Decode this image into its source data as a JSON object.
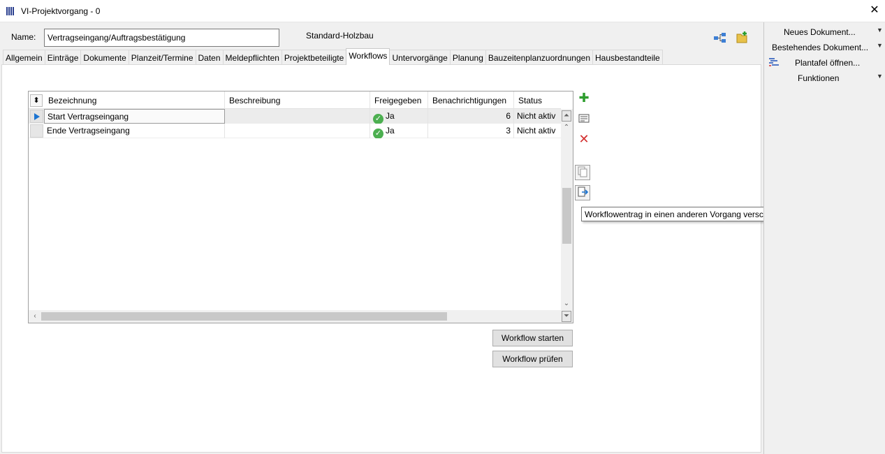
{
  "window": {
    "title": "VI-Projektvorgang - 0",
    "close_glyph": "✕"
  },
  "header": {
    "name_label": "Name:",
    "name_value": "Vertragseingang/Auftragsbestätigung",
    "category": "Standard-Holzbau",
    "icons": [
      "hierarchy-icon",
      "folder-add-icon"
    ]
  },
  "tabs": [
    "Allgemein",
    "Einträge",
    "Dokumente",
    "Planzeit/Termine",
    "Daten",
    "Meldepflichten",
    "Projektbeteiligte",
    "Workflows",
    "Untervorgänge",
    "Planung",
    "Bauzeitenplanzuordnungen",
    "Hausbestandteile"
  ],
  "active_tab": "Workflows",
  "grid": {
    "columns": [
      "Bezeichnung",
      "Beschreibung",
      "Freigegeben",
      "Benachrichtigungen",
      "Status"
    ],
    "rows": [
      {
        "bezeichnung": "Start Vertragseingang",
        "beschreibung": "",
        "freigegeben": "Ja",
        "benachrichtigungen": "6",
        "status": "Nicht aktiv"
      },
      {
        "bezeichnung": "Ende Vertragseingang",
        "beschreibung": "",
        "freigegeben": "Ja",
        "benachrichtigungen": "3",
        "status": "Nicht aktiv"
      }
    ]
  },
  "side_actions": [
    "add-icon",
    "edit-icon",
    "delete-icon",
    "copy-icon",
    "move-icon"
  ],
  "tooltip": "Workflowentrag in einen anderen Vorgang verschieben",
  "buttons": {
    "start": "Workflow starten",
    "check": "Workflow prüfen"
  },
  "right_panel": {
    "items": [
      "Neues Dokument...",
      "Bestehendes Dokument...",
      "Plantafel öffnen...",
      "Funktionen"
    ]
  },
  "colors": {
    "accent": "#1a73d1",
    "ok": "#4caf50",
    "delete": "#d32f2f",
    "add": "#2e9d2e"
  }
}
